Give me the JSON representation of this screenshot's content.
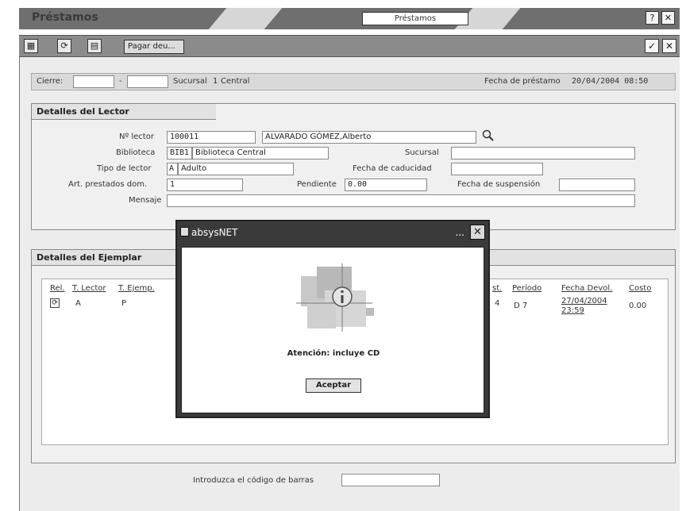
{
  "window": {
    "title": "Préstamos",
    "tab": "Préstamos",
    "help_label": "?",
    "close_label": "✕"
  },
  "toolbar": {
    "pay_label": "Pagar deu...",
    "accept_label": "✓",
    "cancel_label": "✕"
  },
  "top_strip": {
    "cierre_label": "Cierre:",
    "cierre_from": "",
    "dash": "-",
    "cierre_to": "",
    "sucursal_label": "Sucursal",
    "sucursal_code": "1",
    "sucursal_name": "Central",
    "fecha_label": "Fecha de préstamo",
    "fecha_value": "20/04/2004 08:50"
  },
  "reader": {
    "heading": "Detalles del Lector",
    "num_label": "Nº lector",
    "num_value": "100011",
    "name_value": "ALVARADO GÓMEZ,Alberto",
    "biblioteca_label": "Biblioteca",
    "biblioteca_code": "BIB1",
    "biblioteca_name": "Biblioteca Central",
    "sucursal_label": "Sucursal",
    "sucursal_value": "",
    "tipo_label": "Tipo de lector",
    "tipo_code": "A",
    "tipo_name": "Adulto",
    "caducidad_label": "Fecha de caducidad",
    "caducidad_value": "",
    "art_label": "Art. prestados dom.",
    "art_value": "1",
    "pendiente_label": "Pendiente",
    "pendiente_value": "0.00",
    "suspension_label": "Fecha de suspensión",
    "suspension_value": "",
    "mensaje_label": "Mensaje",
    "mensaje_value": ""
  },
  "copy": {
    "heading": "Detalles del Ejemplar",
    "columns": {
      "rel": "Rel.",
      "t_lector": "T. Lector",
      "t_ejemp": "T. Ejemp.",
      "est": "st.",
      "periodo": "Período",
      "fecha": "Fecha Devol.",
      "costo": "Costo"
    },
    "row": {
      "t_lector": "A",
      "t_ejemp": "P",
      "est": "4",
      "periodo": "D 7",
      "fecha_line1": "27/04/2004",
      "fecha_line2": "23:59",
      "costo": "0.00"
    }
  },
  "barcode": {
    "label": "Introduzca el código de barras",
    "value": ""
  },
  "dialog": {
    "title": "absysNET",
    "dots": "...",
    "close": "✕",
    "message": "Atención: incluye CD",
    "ok": "Aceptar"
  },
  "icons": [
    "search-icon",
    "info-icon",
    "renew-icon",
    "app-icon"
  ]
}
